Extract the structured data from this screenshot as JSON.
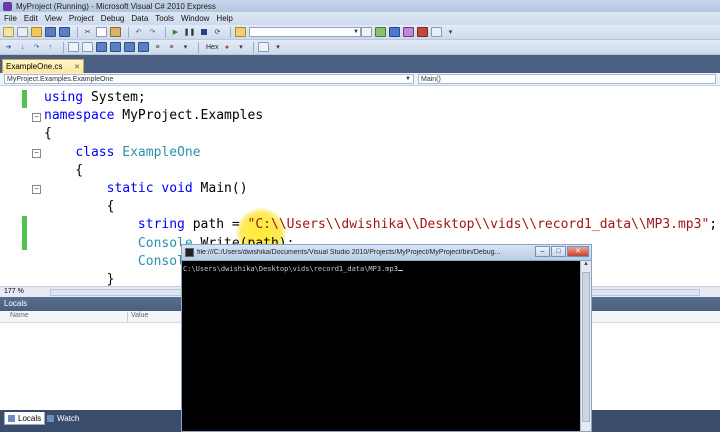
{
  "window": {
    "title": "MyProject (Running) - Microsoft Visual C# 2010 Express"
  },
  "menu": {
    "items": [
      "File",
      "Edit",
      "View",
      "Project",
      "Debug",
      "Data",
      "Tools",
      "Window",
      "Help"
    ]
  },
  "toolbar": {
    "hex_label": "Hex"
  },
  "tabs": {
    "active": "ExampleOne.cs"
  },
  "nav": {
    "type_combo": "MyProject.Examples.ExampleOne",
    "member_combo": "Main()"
  },
  "code": {
    "lines": [
      {
        "tokens": [
          [
            "kw",
            "using"
          ],
          [
            "",
            " System;"
          ]
        ]
      },
      {
        "tokens": [
          [
            "kw",
            "namespace"
          ],
          [
            "",
            " MyProject.Examples"
          ]
        ]
      },
      {
        "tokens": [
          [
            "",
            "{"
          ]
        ]
      },
      {
        "tokens": [
          [
            "",
            "    "
          ],
          [
            "kw",
            "class"
          ],
          [
            "",
            " "
          ],
          [
            "ty",
            "ExampleOne"
          ]
        ]
      },
      {
        "tokens": [
          [
            "",
            "    {"
          ]
        ]
      },
      {
        "tokens": [
          [
            "",
            "        "
          ],
          [
            "kw",
            "static"
          ],
          [
            "",
            " "
          ],
          [
            "kw",
            "void"
          ],
          [
            "",
            " Main()"
          ]
        ]
      },
      {
        "tokens": [
          [
            "",
            "        {"
          ]
        ]
      },
      {
        "tokens": [
          [
            "",
            "            "
          ],
          [
            "kw",
            "string"
          ],
          [
            "",
            " path = "
          ],
          [
            "str",
            "\"C:\\\\Users\\\\dwishika\\\\Desktop\\\\vids\\\\record1_data\\\\MP3.mp3\""
          ],
          [
            "",
            ";"
          ]
        ]
      },
      {
        "tokens": [
          [
            "",
            "            "
          ],
          [
            "ty",
            "Console"
          ],
          [
            "",
            ".Write(path);"
          ]
        ]
      },
      {
        "tokens": [
          [
            "",
            "            "
          ],
          [
            "ty",
            "Console"
          ]
        ]
      },
      {
        "tokens": [
          [
            "",
            "        }"
          ]
        ]
      }
    ]
  },
  "editor_status": {
    "zoom": "177 %"
  },
  "locals": {
    "title": "Locals",
    "col_name": "Name",
    "col_value": "Value"
  },
  "bottom_tabs": [
    "Locals",
    "Watch"
  ],
  "console": {
    "title": "file:///C:/Users/dwishika/Documents/Visual Studio 2010/Projects/MyProject/MyProject/bin/Debug...",
    "output": "C:\\Users\\dwishika\\Desktop\\vids\\record1_data\\MP3.mp3",
    "btn_min": "–",
    "btn_max": "□",
    "btn_close": "✕"
  },
  "colors": {
    "keyword": "#0000ff",
    "type": "#2b91af",
    "string": "#a31515",
    "change_bar": "#4fc24f",
    "highlight": "#ffe62a"
  }
}
